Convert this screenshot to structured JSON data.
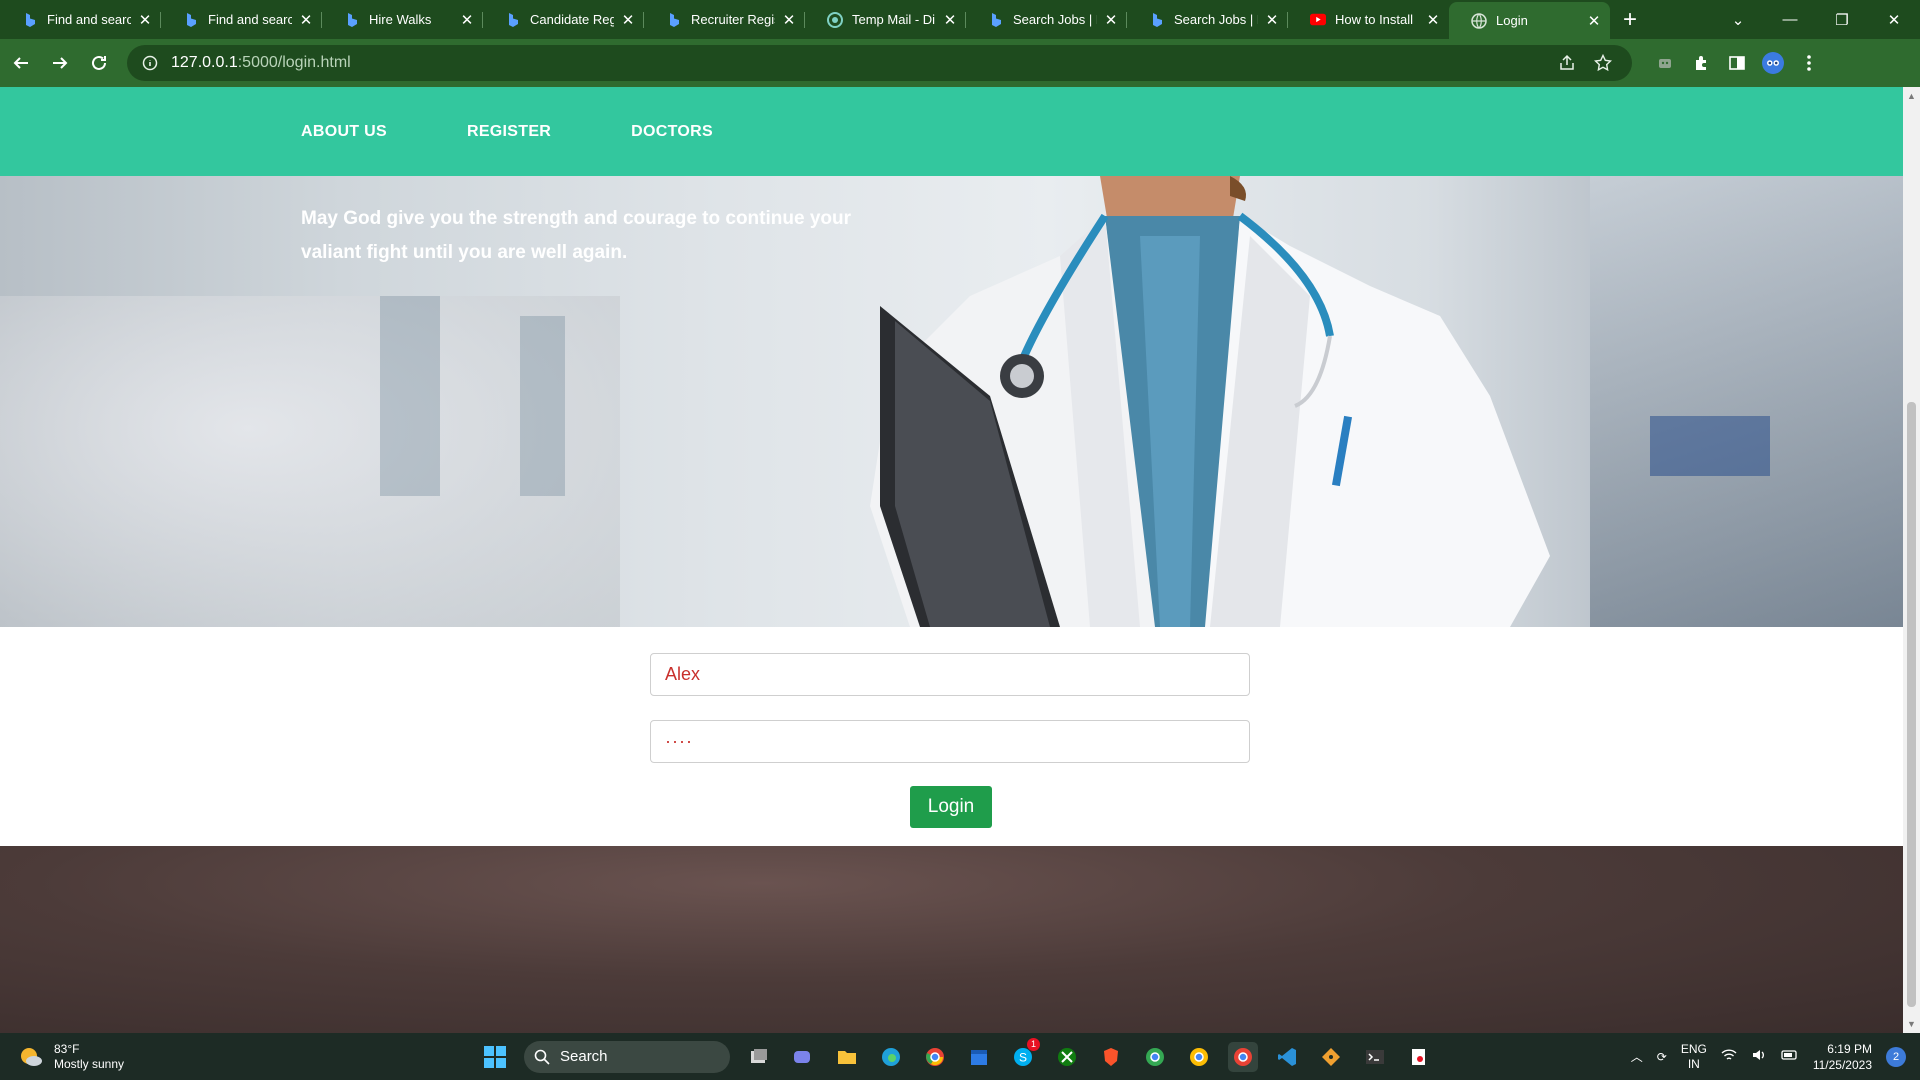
{
  "tabs": [
    {
      "title": "Find and searc",
      "icon": "bing-logo-icon"
    },
    {
      "title": "Find and searc",
      "icon": "bing-logo-icon"
    },
    {
      "title": "Hire Walks",
      "icon": "bing-logo-icon"
    },
    {
      "title": "Candidate Reg",
      "icon": "bing-logo-icon"
    },
    {
      "title": "Recruiter Regis",
      "icon": "bing-logo-icon"
    },
    {
      "title": "Temp Mail - Di",
      "icon": "temp-mail-icon"
    },
    {
      "title": "Search Jobs | L",
      "icon": "bing-logo-icon"
    },
    {
      "title": "Search Jobs | L",
      "icon": "bing-logo-icon"
    },
    {
      "title": "How to Install",
      "icon": "youtube-icon"
    },
    {
      "title": "Login",
      "icon": "globe-icon",
      "active": true
    }
  ],
  "address_bar": {
    "host": "127.0.0.1",
    "rest": ":5000/login.html"
  },
  "nav": {
    "about": "ABOUT US",
    "register": "REGISTER",
    "doctors": "DOCTORS"
  },
  "hero": {
    "quote": "May God give you the strength and courage to continue your valiant fight until you are well again."
  },
  "login": {
    "username_value": "Alex",
    "password_value": "····",
    "button_label": "Login"
  },
  "taskbar": {
    "weather_temp": "83°F",
    "weather_desc": "Mostly sunny",
    "search_label": "Search",
    "lang_top": "ENG",
    "lang_bottom": "IN",
    "time": "6:19 PM",
    "date": "11/25/2023",
    "notification_count": "2",
    "skype_badge": "1"
  },
  "colors": {
    "browser_frame": "#1e4b1e",
    "browser_toolbar": "#2f6b2f",
    "site_nav": "#33c79e",
    "login_button": "#1f9d4b",
    "field_text": "#c9302c"
  }
}
